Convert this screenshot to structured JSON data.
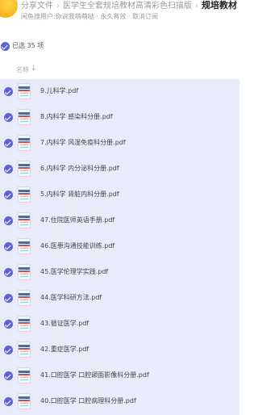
{
  "header": {
    "breadcrumb": [
      {
        "label": "分享文件"
      },
      {
        "label": "医学生全套规培教材高清彩色扫描版"
      },
      {
        "label": "规培教材"
      }
    ],
    "separator": "›",
    "subtitle": "闲鱼搜用户:你说我萌萌哒 · 永久有效 · 取消订阅"
  },
  "selection": {
    "text": "已选 35 项"
  },
  "columns": {
    "name": "名称",
    "sort_icon": "↓"
  },
  "files": [
    {
      "name": "9.儿科学.pdf"
    },
    {
      "name": "8.内科学 感染科分册.pdf"
    },
    {
      "name": "7.内科学 风湿免疫科分册.pdf"
    },
    {
      "name": "6.内科学 内分泌科分册.pdf"
    },
    {
      "name": "5.内科学 肾脏内科分册.pdf"
    },
    {
      "name": "47.住院医师英语手册.pdf"
    },
    {
      "name": "46.医患沟通技能训练.pdf"
    },
    {
      "name": "45.医学伦理学实践.pdf"
    },
    {
      "name": "44.医学科研方法.pdf"
    },
    {
      "name": "43.循证医学.pdf"
    },
    {
      "name": "42.重症医学.pdf"
    },
    {
      "name": "41.口腔医学 口腔颌面影像科分册.pdf"
    },
    {
      "name": "40.口腔医学 口腔病理科分册.pdf"
    }
  ],
  "icons": {
    "avatar": "avatar",
    "check": "check-circle-icon",
    "file": "pdf-file-icon"
  },
  "colors": {
    "accent": "#5a64d6",
    "row_selected_bg": "#e9ebfb"
  }
}
